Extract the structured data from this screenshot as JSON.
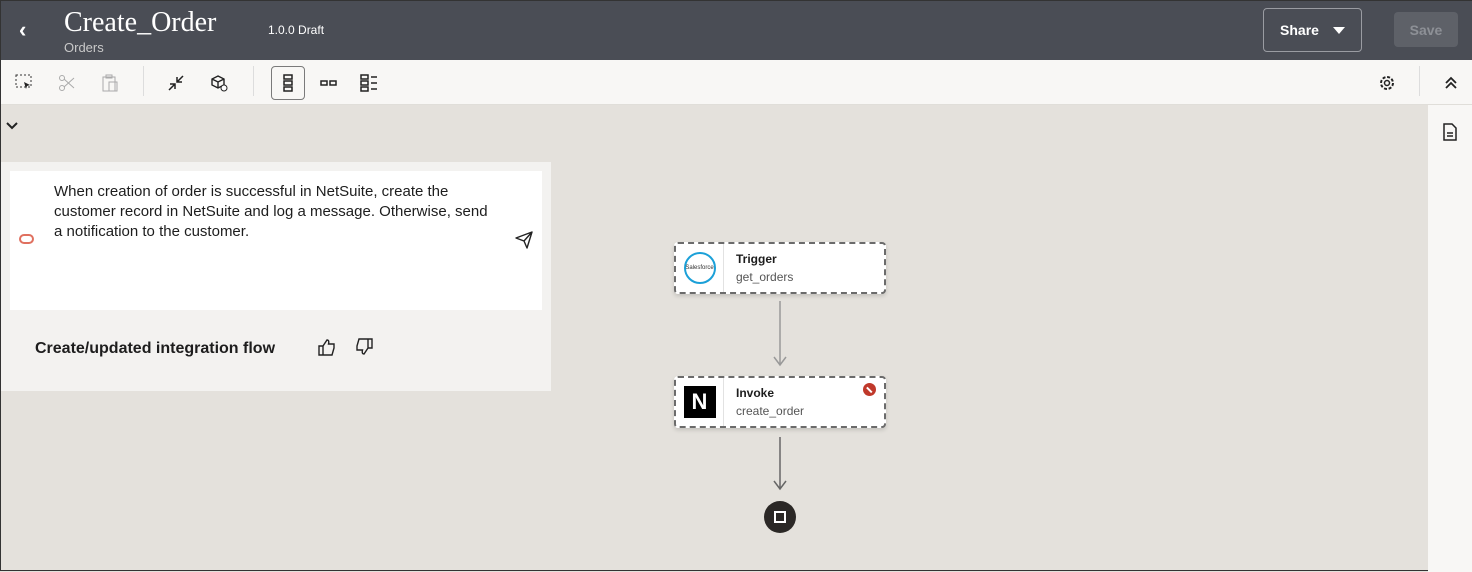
{
  "header": {
    "title": "Create_Order",
    "subtitle": "Orders",
    "version": "1.0.0 Draft",
    "share_label": "Share",
    "save_label": "Save"
  },
  "toolbar": {
    "icons": [
      "select-icon",
      "cut-icon",
      "paste-icon",
      "collapse-icon",
      "package-icon",
      "vertical-layout-icon",
      "horizontal-layout-icon",
      "pseudo-layout-icon",
      "settings-icon",
      "collapse-up-icon"
    ]
  },
  "assistant": {
    "prompt": "When creation of order is successful in NetSuite, create the customer record in NetSuite and log a message. Otherwise, send a notification to the customer.",
    "feedback_label": "Create/updated integration flow"
  },
  "flow": {
    "nodes": [
      {
        "type": "Trigger",
        "name": "get_orders",
        "logo": "Salesforce"
      },
      {
        "type": "Invoke",
        "name": "create_order",
        "logo": "N",
        "status": "error"
      }
    ]
  },
  "colors": {
    "header": "#4a4d55",
    "error": "#c0392b",
    "salesforce": "#1ba0d8"
  }
}
